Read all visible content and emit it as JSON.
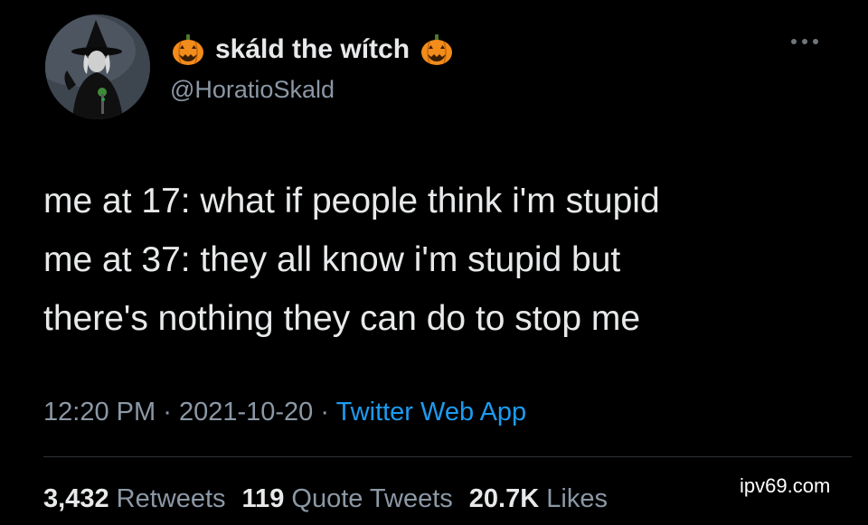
{
  "user": {
    "display_name": "skáld the wítch",
    "handle": "@HoratioSkald",
    "name_emoji_icon": "jack-o-lantern-icon"
  },
  "tweet": {
    "lines": [
      "me at 17: what if people think i'm stupid",
      "me at 37: they all know i'm stupid but",
      "there's nothing they can do to stop me"
    ]
  },
  "meta": {
    "time": "12:20 PM",
    "separator": "·",
    "date": "2021-10-20",
    "source": "Twitter Web App"
  },
  "stats": {
    "retweets_count": "3,432",
    "retweets_label": "Retweets",
    "quotes_count": "119",
    "quotes_label": "Quote Tweets",
    "likes_count": "20.7K",
    "likes_label": "Likes"
  },
  "watermark": "ipv69.com",
  "colors": {
    "background": "#000000",
    "text": "#e7e9ea",
    "secondary": "#8b98a5",
    "link": "#1d9bf0",
    "divider": "#2f3336"
  }
}
